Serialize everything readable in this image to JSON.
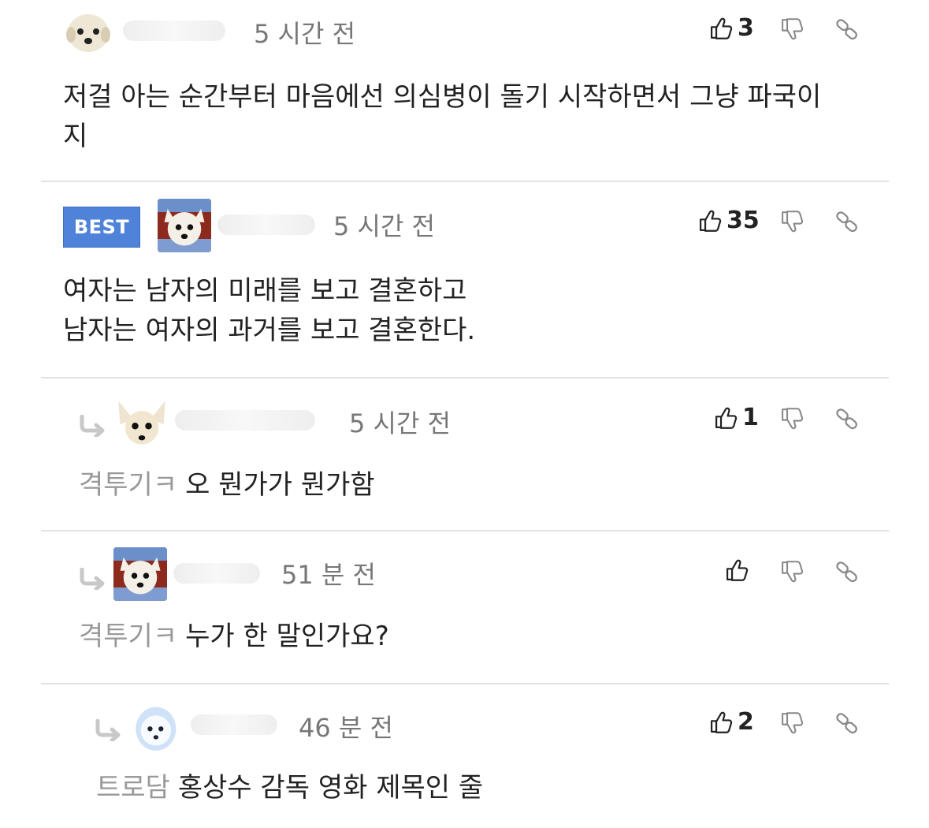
{
  "comments": [
    {
      "time": "5 시간 전",
      "likes": "3",
      "text": "저걸 아는 순간부터 마음에선 의심병이 돌기 시작하면서 그냥 파국이\n지"
    },
    {
      "badge": "BEST",
      "time": "5 시간 전",
      "likes": "35",
      "text": "여자는 남자의 미래를 보고 결혼하고\n남자는 여자의 과거를 보고 결혼한다."
    },
    {
      "time": "5 시간 전",
      "likes": "1",
      "prefix": "격투기ㅋ",
      "text": "오 뭔가가 뭔가함"
    },
    {
      "time": "51 분 전",
      "likes": "",
      "prefix": "격투기ㅋ",
      "text": "누가 한 말인가요?"
    },
    {
      "time": "46 분 전",
      "likes": "2",
      "prefix": "트로담",
      "text": "홍상수 감독 영화 제목인 줄"
    }
  ],
  "icons": {
    "like": "thumbs-up-icon",
    "dislike": "thumbs-down-icon",
    "link": "link-icon",
    "reply": "reply-arrow-icon"
  }
}
